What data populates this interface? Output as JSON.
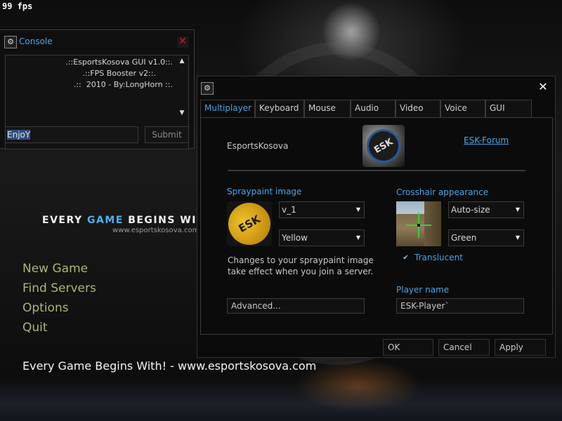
{
  "overlay": {
    "fps": "99 fps"
  },
  "console": {
    "title": "Console",
    "icon": "steam-icon",
    "log": [
      ".::EsportsKosova GUI v1.0::.",
      ".::FPS Booster v2::.",
      ".::  2010 - By:LongHorn ::."
    ],
    "input_value": "EnjoY",
    "submit_label": "Submit"
  },
  "brand": {
    "tagline_part1": "EVERY ",
    "tagline_highlight": "GAME",
    "tagline_part2": " BEGINS WITH",
    "url": "www.esportskosova.com",
    "bottom_text": "Every Game Begins With! - www.esportskosova.com"
  },
  "menu": {
    "items": [
      "New Game",
      "Find Servers",
      "Options",
      "Quit"
    ]
  },
  "options": {
    "tabs": [
      "Multiplayer",
      "Keyboard",
      "Mouse",
      "Audio",
      "Video",
      "Voice",
      "GUI"
    ],
    "active_tab": "Multiplayer",
    "org_name": "EsportsKosova",
    "forum_link": "ESK-Forum",
    "logo_text": "ESK",
    "spraypaint": {
      "label": "Spraypaint image",
      "image_value": "v_1",
      "color_value": "Yellow",
      "info": "Changes to your spraypaint image take effect when you join a server.",
      "advanced_label": "Advanced..."
    },
    "crosshair": {
      "label": "Crosshair appearance",
      "size_value": "Auto-size",
      "color_value": "Green",
      "translucent_label": "Translucent",
      "translucent_checked": true
    },
    "player": {
      "label": "Player name",
      "value": "ESK-Player`"
    },
    "buttons": {
      "ok": "OK",
      "cancel": "Cancel",
      "apply": "Apply"
    },
    "colors": {
      "accent": "#4da3e6",
      "menu_text": "#a8b870",
      "close_red": "#d01c1c"
    }
  }
}
